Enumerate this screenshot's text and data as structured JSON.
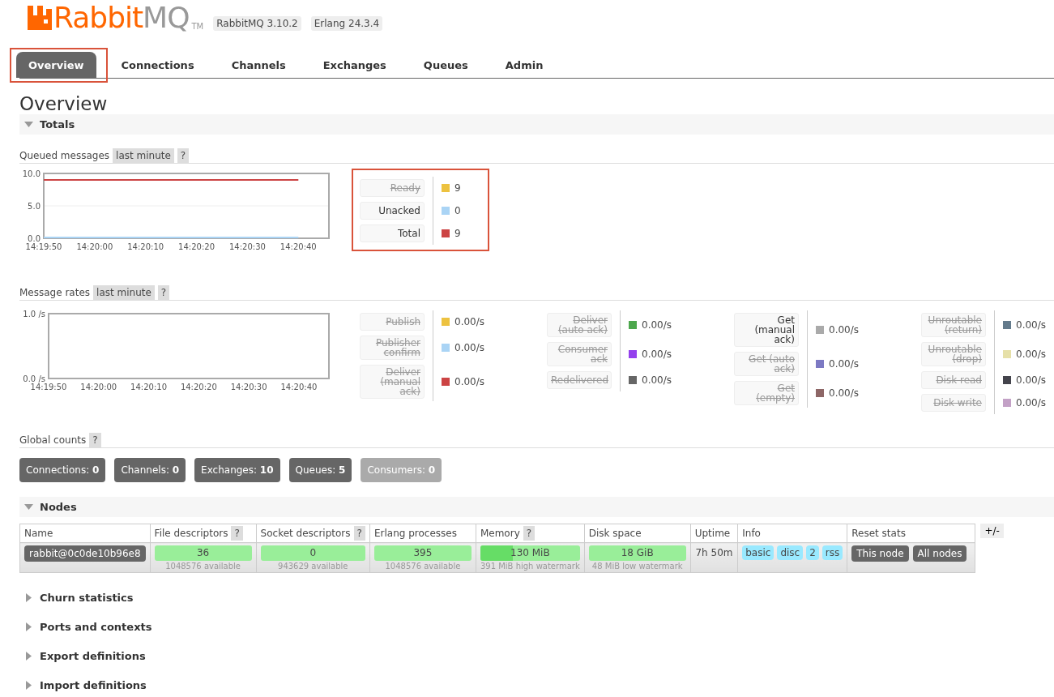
{
  "header": {
    "logo_main": "Rabbit",
    "logo_rest": "MQ",
    "logo_tm": "TM",
    "versions": [
      "RabbitMQ 3.10.2",
      "Erlang 24.3.4"
    ]
  },
  "tabs": [
    {
      "label": "Overview",
      "selected": true,
      "highlighted": true
    },
    {
      "label": "Connections",
      "selected": false,
      "highlighted": false
    },
    {
      "label": "Channels",
      "selected": false,
      "highlighted": false
    },
    {
      "label": "Exchanges",
      "selected": false,
      "highlighted": false
    },
    {
      "label": "Queues",
      "selected": false,
      "highlighted": false
    },
    {
      "label": "Admin",
      "selected": false,
      "highlighted": false
    }
  ],
  "page_title": "Overview",
  "totals": {
    "title": "Totals",
    "expanded": true,
    "queued": {
      "label": "Queued messages",
      "range": "last minute",
      "help": "?",
      "highlighted": true,
      "chart_data": {
        "type": "line",
        "categories": [
          "14:19:50",
          "14:20:00",
          "14:20:10",
          "14:20:20",
          "14:20:30",
          "14:20:40"
        ],
        "ylim": [
          0,
          10
        ],
        "yticks": [
          {
            "value": 0,
            "label": "0.0"
          },
          {
            "value": 5,
            "label": "5.0"
          },
          {
            "value": 10,
            "label": "10.0"
          }
        ],
        "series": [
          {
            "color": "#aad4f5",
            "values": [
              0,
              0,
              0,
              0,
              0,
              0
            ]
          },
          {
            "color": "#cc4444",
            "values": [
              9,
              9,
              9,
              9,
              9,
              9
            ]
          }
        ]
      },
      "legend": [
        {
          "label": "Ready",
          "value": "9",
          "color": "#edc240",
          "enabled": false
        },
        {
          "label": "Unacked",
          "value": "0",
          "color": "#aad4f5",
          "enabled": true
        },
        {
          "label": "Total",
          "value": "9",
          "color": "#cc4444",
          "enabled": true
        }
      ]
    },
    "rates": {
      "label": "Message rates",
      "range": "last minute",
      "help": "?",
      "chart_data": {
        "type": "line",
        "categories": [
          "14:19:50",
          "14:20:00",
          "14:20:10",
          "14:20:20",
          "14:20:30",
          "14:20:40"
        ],
        "ylim": [
          0,
          1
        ],
        "yticks": [
          {
            "value": 0,
            "label": "0.0 /s"
          },
          {
            "value": 1,
            "label": "1.0 /s"
          }
        ]
      },
      "legend_groups": [
        [
          {
            "label": "Publish",
            "value": "0.00/s",
            "color": "#edc240",
            "enabled": false
          },
          {
            "label": "Publisher confirm",
            "value": "0.00/s",
            "color": "#aad4f5",
            "enabled": false
          },
          {
            "label": "Deliver (manual ack)",
            "value": "0.00/s",
            "color": "#cc4444",
            "enabled": false
          }
        ],
        [
          {
            "label": "Deliver (auto ack)",
            "value": "0.00/s",
            "color": "#4da74d",
            "enabled": false
          },
          {
            "label": "Consumer ack",
            "value": "0.00/s",
            "color": "#9440ed",
            "enabled": false
          },
          {
            "label": "Redelivered",
            "value": "0.00/s",
            "color": "#666666",
            "enabled": false
          }
        ],
        [
          {
            "label": "Get (manual ack)",
            "value": "0.00/s",
            "color": "#aaaaaa",
            "enabled": true
          },
          {
            "label": "Get (auto ack)",
            "value": "0.00/s",
            "color": "#7c79c3",
            "enabled": false
          },
          {
            "label": "Get (empty)",
            "value": "0.00/s",
            "color": "#8d6666",
            "enabled": false
          }
        ],
        [
          {
            "label": "Unroutable (return)",
            "value": "0.00/s",
            "color": "#647b8c",
            "enabled": false
          },
          {
            "label": "Unroutable (drop)",
            "value": "0.00/s",
            "color": "#e6e0a8",
            "enabled": false
          },
          {
            "label": "Disk read",
            "value": "0.00/s",
            "color": "#44444c",
            "enabled": false
          },
          {
            "label": "Disk write",
            "value": "0.00/s",
            "color": "#c3a1c6",
            "enabled": false
          }
        ]
      ]
    },
    "global": {
      "label": "Global counts",
      "help": "?",
      "counts": [
        {
          "text": "Connections: **0**",
          "disabled": false
        },
        {
          "text": "Channels: **0**",
          "disabled": false
        },
        {
          "text": "Exchanges: **10**",
          "disabled": false
        },
        {
          "text": "Queues: **5**",
          "disabled": false
        },
        {
          "text": "Consumers: **0**",
          "disabled": true
        }
      ]
    }
  },
  "nodes": {
    "title": "Nodes",
    "expanded": true,
    "toggle": "+/-",
    "columns": [
      {
        "label": "Name"
      },
      {
        "label": "File descriptors",
        "help": "?"
      },
      {
        "label": "Socket descriptors",
        "help": "?"
      },
      {
        "label": "Erlang processes"
      },
      {
        "label": "Memory",
        "help": "?"
      },
      {
        "label": "Disk space"
      },
      {
        "label": "Uptime"
      },
      {
        "label": "Info"
      },
      {
        "label": "Reset stats"
      }
    ],
    "rows": [
      {
        "name": "rabbit@0c0de10b96e8",
        "metrics": [
          {
            "value": "36",
            "note": "1048576 available"
          },
          {
            "value": "0",
            "note": "943629 available"
          },
          {
            "value": "395",
            "note": "1048576 available"
          },
          {
            "value": "130 MiB",
            "note": "391 MiB high watermark",
            "level": 0.33
          },
          {
            "value": "18 GiB",
            "note": "48 MiB low watermark"
          }
        ],
        "uptime": "7h 50m",
        "info": [
          "basic",
          "disc",
          "2",
          "rss"
        ],
        "reset": [
          "This node",
          "All nodes"
        ]
      }
    ]
  },
  "sections": [
    {
      "title": "Churn statistics",
      "expanded": false
    },
    {
      "title": "Ports and contexts",
      "expanded": false
    },
    {
      "title": "Export definitions",
      "expanded": false
    },
    {
      "title": "Import definitions",
      "expanded": false
    }
  ]
}
